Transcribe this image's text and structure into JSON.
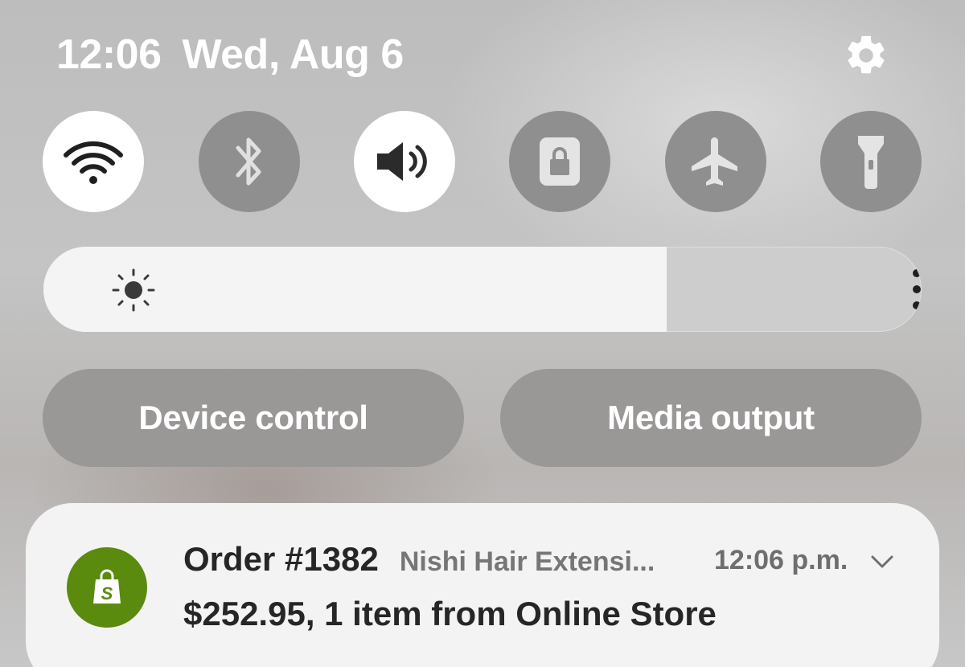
{
  "status": {
    "time": "12:06",
    "date": "Wed, Aug 6"
  },
  "quick_tiles": [
    {
      "name": "wifi",
      "icon": "wifi-icon",
      "state": "on"
    },
    {
      "name": "bluetooth",
      "icon": "bluetooth-icon",
      "state": "off"
    },
    {
      "name": "sound",
      "icon": "sound-icon",
      "state": "on"
    },
    {
      "name": "screen-lock",
      "icon": "lock-icon",
      "state": "off"
    },
    {
      "name": "airplane-mode",
      "icon": "airplane-icon",
      "state": "off"
    },
    {
      "name": "flashlight",
      "icon": "flashlight-icon",
      "state": "off"
    }
  ],
  "brightness": {
    "level": 0.71,
    "icon": "sun-icon"
  },
  "buttons": {
    "device_control": "Device control",
    "media_output": "Media output"
  },
  "notification": {
    "icon": "shopify-icon",
    "title": "Order #1382",
    "app": "Nishi Hair Extensi...",
    "time": "12:06 p.m.",
    "body": "$252.95, 1 item from Online Store"
  },
  "colors": {
    "tile_on": "#ffffff",
    "tile_off": "#8f8f8f",
    "shopify_green": "#5a8a0e"
  }
}
